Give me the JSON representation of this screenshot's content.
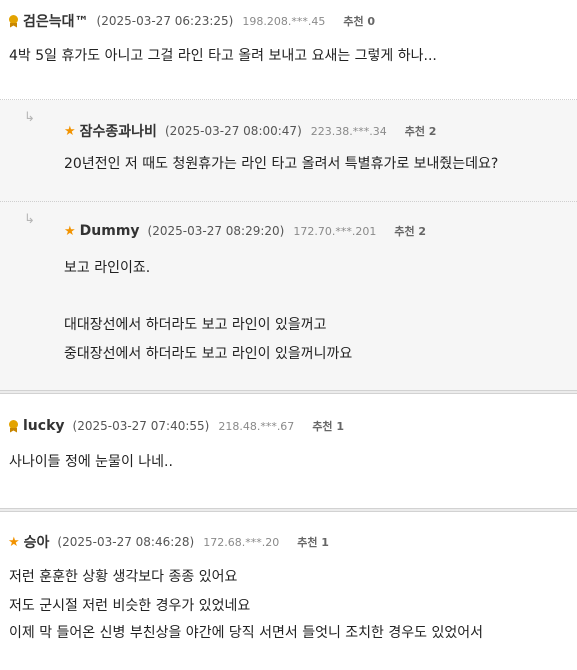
{
  "comments": [
    {
      "nick": "검은늑대™",
      "date": "(2025-03-27 06:23:25)",
      "ip": "198.208.***.45",
      "rec": "추천 0",
      "lines": [
        "4박 5일 휴가도 아니고 그걸 라인 타고 올려 보내고 요새는 그렇게 하나..."
      ]
    },
    {
      "nick": "잠수종과나비",
      "date": "(2025-03-27 08:00:47)",
      "ip": "223.38.***.34",
      "rec": "추천 2",
      "lines": [
        "20년전인 저 때도 청원휴가는 라인 타고 올려서 특별휴가로 보내줬는데요?"
      ]
    },
    {
      "nick": "Dummy",
      "date": "(2025-03-27 08:29:20)",
      "ip": "172.70.***.201",
      "rec": "추천 2",
      "lines": [
        "보고 라인이죠.",
        "대대장선에서 하더라도 보고 라인이 있을꺼고",
        "중대장선에서 하더라도 보고 라인이 있을꺼니까요"
      ]
    },
    {
      "nick": "lucky",
      "date": "(2025-03-27 07:40:55)",
      "ip": "218.48.***.67",
      "rec": "추천 1",
      "lines": [
        "사나이들 정에 눈물이 나네.."
      ]
    },
    {
      "nick": "승아",
      "date": "(2025-03-27 08:46:28)",
      "ip": "172.68.***.20",
      "rec": "추천 1",
      "lines": [
        "저런 훈훈한 상황 생각보다 종종 있어요",
        "저도 군시절 저런 비슷한 경우가 있었네요",
        "이제 막 들어온 신병 부친상을 야간에 당직 서면서 들엇니 조치한 경우도 있었어서"
      ]
    }
  ],
  "icons": {
    "reply": "reply-arrow-icon",
    "medal": "medal-icon",
    "star": "star-icon"
  },
  "colors": {
    "star": "#f29300",
    "medal": "#e3a300",
    "reply_bg": "#f6f6f6"
  }
}
